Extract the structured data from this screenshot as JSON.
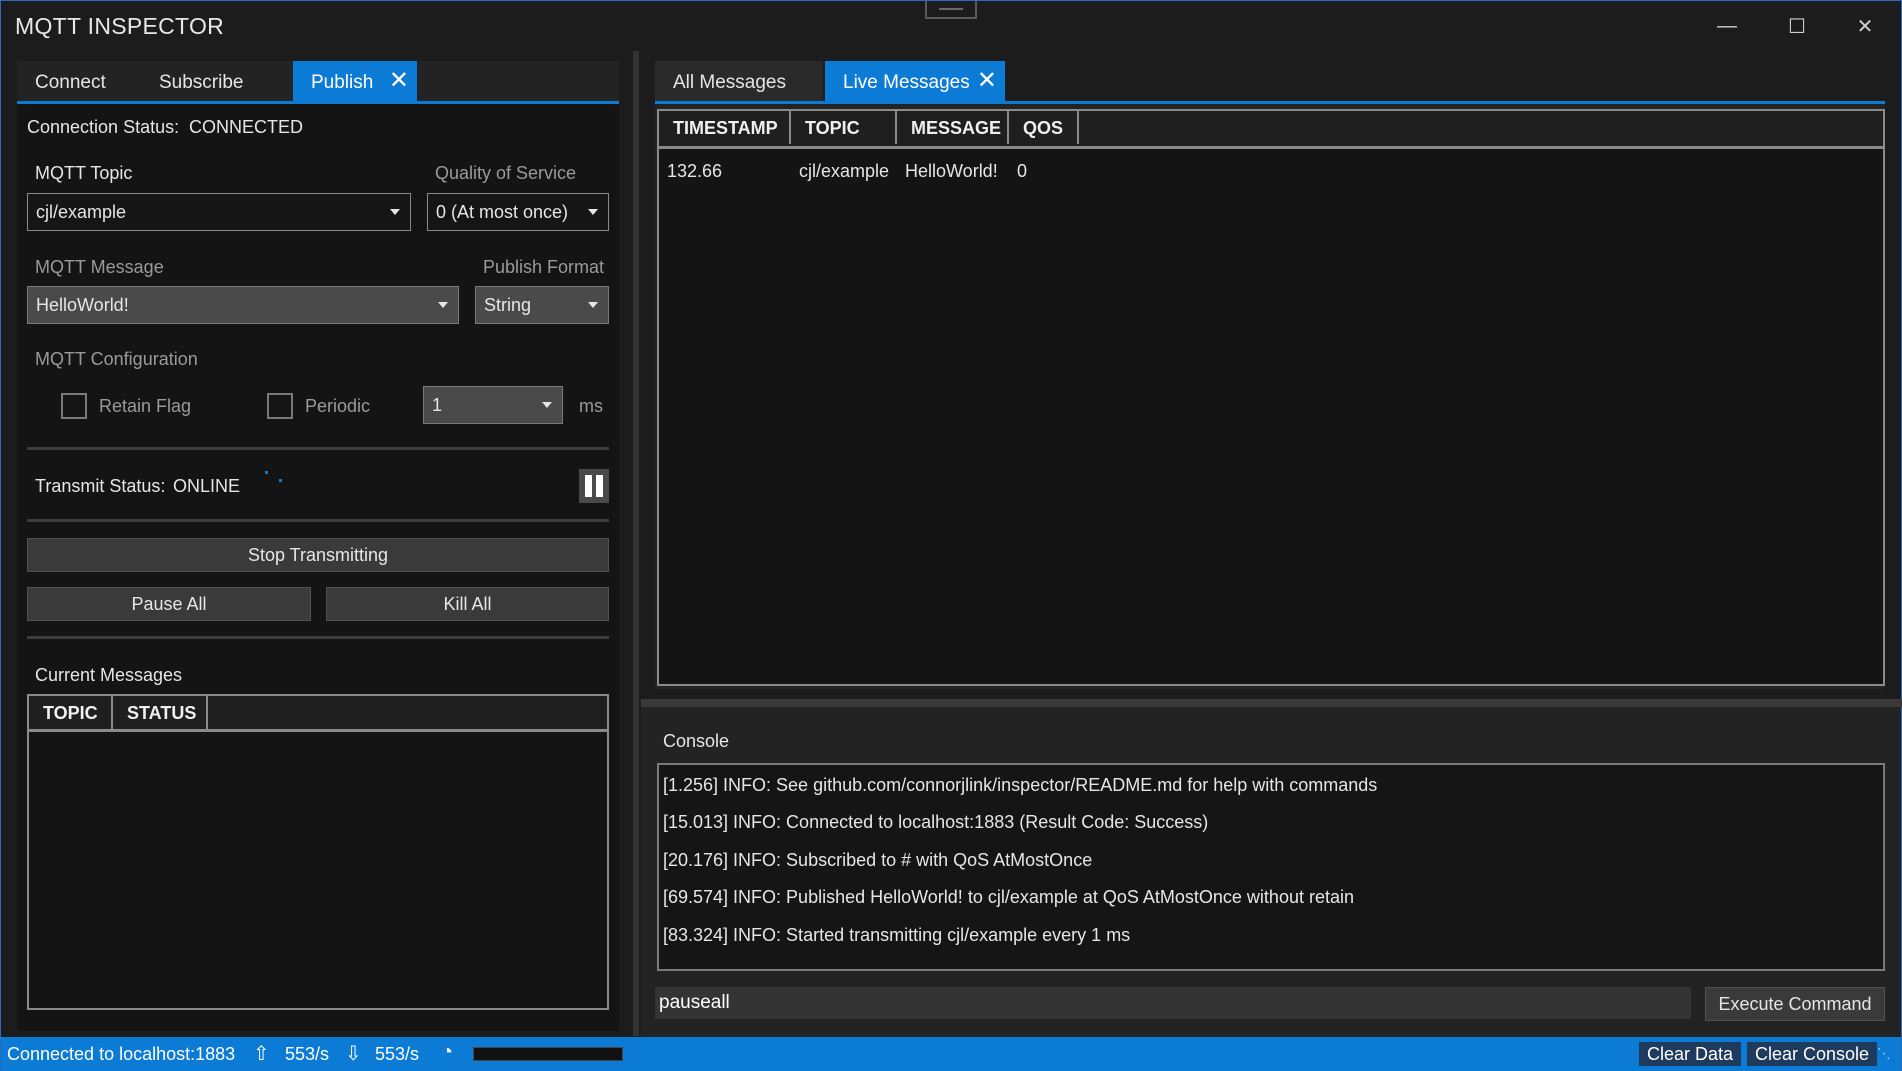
{
  "window": {
    "title": "MQTT INSPECTOR"
  },
  "left_tabs": [
    "Connect",
    "Subscribe",
    "Publish"
  ],
  "connection": {
    "label": "Connection Status:",
    "value": "CONNECTED"
  },
  "publish": {
    "topic_label": "MQTT Topic",
    "topic_value": "cjl/example",
    "qos_label": "Quality of Service",
    "qos_value": "0 (At most once)",
    "message_label": "MQTT Message",
    "message_value": "HelloWorld!",
    "format_label": "Publish Format",
    "format_value": "String",
    "config_label": "MQTT Configuration",
    "retain_label": "Retain Flag",
    "periodic_label": "Periodic",
    "period_value": "1",
    "period_unit": "ms"
  },
  "transmit": {
    "label": "Transmit Status:",
    "value": "ONLINE"
  },
  "buttons": {
    "stop": "Stop Transmitting",
    "pause_all": "Pause All",
    "kill_all": "Kill All",
    "execute": "Execute Command",
    "clear_data": "Clear Data",
    "clear_console": "Clear Console"
  },
  "current_messages": {
    "label": "Current Messages",
    "columns": [
      "TOPIC",
      "STATUS"
    ]
  },
  "right_tabs": [
    "All Messages",
    "Live Messages"
  ],
  "messages_table": {
    "columns": [
      "TIMESTAMP",
      "TOPIC",
      "MESSAGE",
      "QOS"
    ],
    "rows": [
      {
        "timestamp": "132.66",
        "topic": "cjl/example",
        "message": "HelloWorld!",
        "qos": "0"
      }
    ]
  },
  "console": {
    "label": "Console",
    "lines": [
      "[1.256] INFO: See github.com/connorjlink/inspector/README.md for help with commands",
      "[15.013] INFO: Connected to localhost:1883 (Result Code: Success)",
      "[20.176] INFO: Subscribed to # with QoS AtMostOnce",
      "[69.574] INFO: Published HelloWorld! to cjl/example at QoS AtMostOnce without retain",
      "[83.324] INFO: Started transmitting cjl/example every 1 ms"
    ],
    "input_value": "pauseall"
  },
  "statusbar": {
    "connection": "Connected to localhost:1883",
    "upload_rate": "553/s",
    "download_rate": "553/s"
  },
  "colors": {
    "accent": "#0c7bd6",
    "background": "#1c1c1c"
  }
}
